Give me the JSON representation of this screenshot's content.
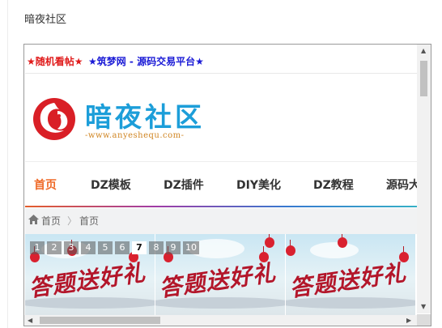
{
  "page": {
    "heading": "暗夜社区"
  },
  "topbar": {
    "links": [
      {
        "label": "★随机看帖★",
        "color": "#e01b1b"
      },
      {
        "label": "★筑梦网 - 源码交易平台★",
        "color": "#1a1ad6"
      }
    ]
  },
  "header": {
    "logo_title": "暗夜社区",
    "logo_url": "-www.anyeshequ.com-",
    "brand_color": "#1c9ed9"
  },
  "nav": {
    "items": [
      {
        "label": "首页",
        "active": true
      },
      {
        "label": "DZ模板",
        "active": false
      },
      {
        "label": "DZ插件",
        "active": false
      },
      {
        "label": "DIY美化",
        "active": false
      },
      {
        "label": "DZ教程",
        "active": false
      },
      {
        "label": "源码大",
        "active": false
      }
    ],
    "active_color": "#ef6a28"
  },
  "breadcrumb": {
    "icon": "home-icon",
    "items": [
      "首页",
      "首页"
    ],
    "separator": "〉"
  },
  "slider": {
    "pages": [
      "1",
      "2",
      "3",
      "4",
      "5",
      "6",
      "7",
      "8",
      "9",
      "10"
    ],
    "active_page": "7",
    "banner_text": "答题送好礼"
  }
}
